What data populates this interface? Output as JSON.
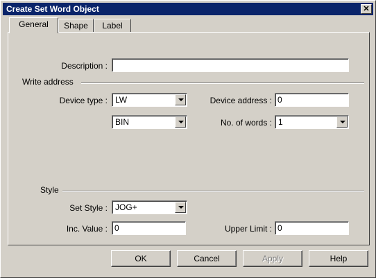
{
  "window": {
    "title": "Create Set Word Object",
    "close_glyph": "✕"
  },
  "tabs": [
    {
      "label": "General",
      "selected": true
    },
    {
      "label": "Shape",
      "selected": false
    },
    {
      "label": "Label",
      "selected": false
    }
  ],
  "general": {
    "description_label": "Description :",
    "description_value": "",
    "write_address_group": "Write address",
    "device_type_label": "Device type :",
    "device_type_value": "LW",
    "format_value": "BIN",
    "device_address_label": "Device address :",
    "device_address_value": "0",
    "no_of_words_label": "No. of words :",
    "no_of_words_value": "1",
    "style_group": "Style",
    "set_style_label": "Set Style :",
    "set_style_value": "JOG+",
    "inc_value_label": "Inc. Value :",
    "inc_value_value": "0",
    "upper_limit_label": "Upper Limit :",
    "upper_limit_value": "0"
  },
  "buttons": {
    "ok": "OK",
    "cancel": "Cancel",
    "apply": "Apply",
    "help": "Help"
  },
  "colors": {
    "titlebar": "#0a246a",
    "face": "#d4d0c8"
  }
}
